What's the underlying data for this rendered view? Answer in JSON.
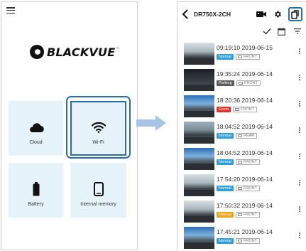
{
  "left_screen": {
    "logo_text": "BLACKVUE",
    "logo_tm": "™",
    "tiles": [
      {
        "label": "Cloud",
        "icon": "cloud-icon"
      },
      {
        "label": "Wi-Fi",
        "icon": "wifi-icon"
      },
      {
        "label": "Battery",
        "icon": "battery-icon"
      },
      {
        "label": "Internal memory",
        "icon": "internal-memory-icon"
      }
    ]
  },
  "right_screen": {
    "device_title": "DR750X-2CH",
    "recordings": [
      {
        "time": "09:19:10",
        "date": "2019-06-15",
        "type": "Normal",
        "camera": "FRONT"
      },
      {
        "time": "19:35:24",
        "date": "2019-06-14",
        "type": "Parking",
        "camera": "FRONT"
      },
      {
        "time": "18:20:36",
        "date": "2019-06-14",
        "type": "Event",
        "camera": "FRONT"
      },
      {
        "time": "18:04:52",
        "date": "2019-06-14",
        "type": "Normal",
        "camera": "REAR"
      },
      {
        "time": "18:04:52",
        "date": "2019-06-14",
        "type": "Normal",
        "camera": "FRONT"
      },
      {
        "time": "17:54:20",
        "date": "2019-06-14",
        "type": "Normal",
        "camera": "FRONT"
      },
      {
        "time": "17:50:32",
        "date": "2019-06-14",
        "type": "Manual",
        "camera": "FRONT"
      },
      {
        "time": "17:45:21",
        "date": "2019-06-14",
        "type": "Normal",
        "camera": "FRONT"
      }
    ],
    "badge_colors": {
      "Normal": "#2f9fd8",
      "Parking": "#5b5b5b",
      "Event": "#e0322b",
      "Manual": "#f0a21b"
    }
  },
  "colors": {
    "highlight": "#2a6fa6",
    "tile_bg": "#e6f3fb",
    "arrow": "#a8c4e4"
  }
}
